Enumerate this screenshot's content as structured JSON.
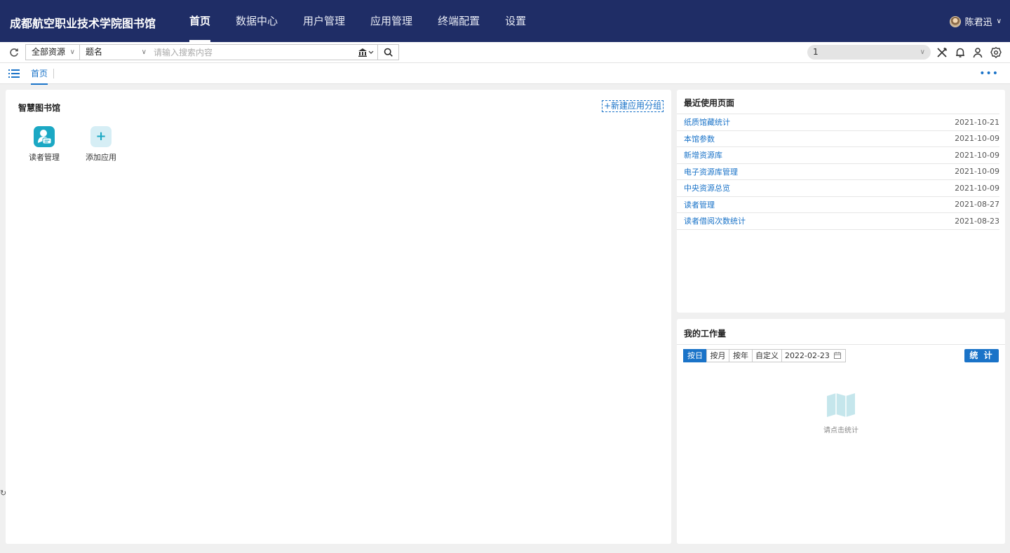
{
  "header": {
    "brand": "成都航空职业技术学院图书馆",
    "nav": [
      {
        "label": "首页",
        "active": true
      },
      {
        "label": "数据中心"
      },
      {
        "label": "用户管理"
      },
      {
        "label": "应用管理"
      },
      {
        "label": "终端配置"
      },
      {
        "label": "设置"
      }
    ],
    "user_name": "陈君迅"
  },
  "searchbar": {
    "resource_select": "全部资源",
    "field_select": "题名",
    "placeholder": "请输入搜索内容",
    "right_select": "1"
  },
  "tabs": {
    "home": "首页"
  },
  "main": {
    "title": "智慧图书馆",
    "new_group_label": "+新建应用分组",
    "apps": [
      {
        "label": "读者管理",
        "icon": "reader-management-icon"
      },
      {
        "label": "添加应用",
        "icon": "plus-icon"
      }
    ]
  },
  "recent": {
    "title": "最近使用页面",
    "items": [
      {
        "label": "纸质馆藏统计",
        "date": "2021-10-21"
      },
      {
        "label": "本馆参数",
        "date": "2021-10-09"
      },
      {
        "label": "新增资源库",
        "date": "2021-10-09"
      },
      {
        "label": "电子资源库管理",
        "date": "2021-10-09"
      },
      {
        "label": "中央资源总览",
        "date": "2021-10-09"
      },
      {
        "label": "读者管理",
        "date": "2021-08-27"
      },
      {
        "label": "读者借阅次数统计",
        "date": "2021-08-23"
      }
    ]
  },
  "workload": {
    "title": "我的工作量",
    "segments": [
      "按日",
      "按月",
      "按年",
      "自定义"
    ],
    "active_segment": "按日",
    "date": "2022-02-23",
    "stat_button": "统 计",
    "empty_text": "请点击统计"
  },
  "colors": {
    "header_bg": "#1f2d66",
    "accent": "#1a73c8",
    "app_icon": "#1ba8c4"
  }
}
